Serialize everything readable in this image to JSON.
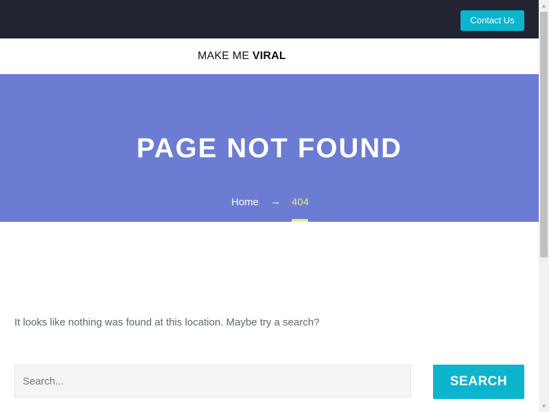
{
  "topbar": {
    "contact_label": "Contact Us"
  },
  "header": {
    "logo_part1": "MAKE ME ",
    "logo_part2": "VIRAL"
  },
  "hero": {
    "title": "PAGE NOT FOUND",
    "breadcrumb": {
      "home": "Home",
      "separator": "→",
      "current": "404"
    }
  },
  "main": {
    "message": "It looks like nothing was found at this location. Maybe try a search?",
    "search": {
      "placeholder": "Search...",
      "value": "",
      "button_label": "SEARCH"
    }
  },
  "scrollbar": {
    "up_glyph": "▲",
    "down_glyph": "▼"
  },
  "colors": {
    "topbar_bg": "#222431",
    "accent": "#0cb4ce",
    "hero_bg": "#6c7cd3",
    "breadcrumb_current": "#e8ec88",
    "body_text": "#5a6673"
  }
}
